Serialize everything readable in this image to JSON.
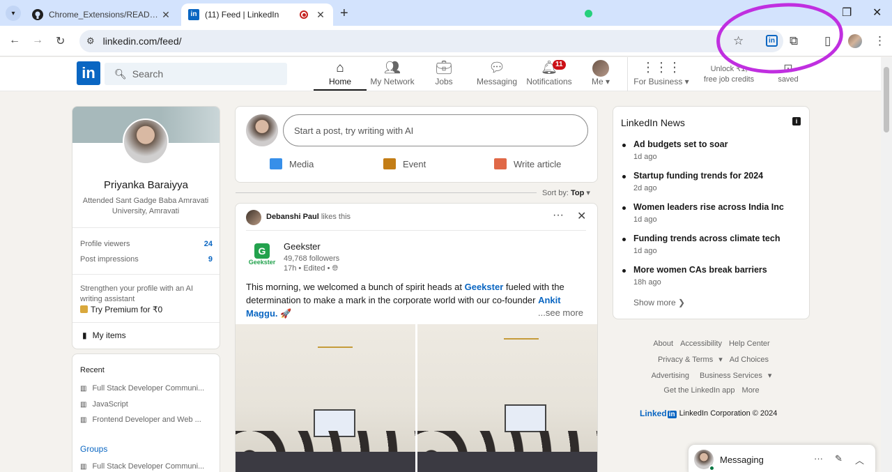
{
  "browser": {
    "tabs": [
      {
        "title": "Chrome_Extensions/README.m",
        "active": false,
        "icon": "github-icon"
      },
      {
        "title": "(11) Feed | LinkedIn",
        "active": true,
        "icon": "linkedin-icon"
      }
    ],
    "url": "linkedin.com/feed/"
  },
  "header": {
    "search_placeholder": "Search",
    "nav": [
      {
        "label": "Home",
        "icon": "home-icon"
      },
      {
        "label": "My Network",
        "icon": "network-icon"
      },
      {
        "label": "Jobs",
        "icon": "briefcase-icon"
      },
      {
        "label": "Messaging",
        "icon": "chat-icon"
      },
      {
        "label": "Notifications",
        "icon": "bell-icon",
        "badge": "11"
      },
      {
        "label": "Me",
        "icon": "avatar"
      },
      {
        "label": "For Business",
        "icon": "grid-icon"
      }
    ],
    "unlock_line1": "Unlock ₹1,",
    "unlock_line2": "free job credits",
    "saved": "saved"
  },
  "profile": {
    "name": "Priyanka Baraiyya",
    "subtitle": "Attended Sant Gadge Baba Amravati University, Amravati",
    "viewers_label": "Profile viewers",
    "viewers_value": "24",
    "impressions_label": "Post impressions",
    "impressions_value": "9",
    "premium_text": "Strengthen your profile with an AI writing assistant",
    "premium_link": "Try Premium for ₹0",
    "my_items": "My items"
  },
  "recent": {
    "heading": "Recent",
    "items": [
      "Full Stack Developer Communi...",
      "JavaScript",
      "Frontend Developer and Web ..."
    ],
    "groups_heading": "Groups",
    "groups_items": [
      "Full Stack Developer Communi..."
    ]
  },
  "share": {
    "placeholder": "Start a post, try writing with AI",
    "actions": [
      "Media",
      "Event",
      "Write article"
    ]
  },
  "sort": {
    "label": "Sort by:",
    "value": "Top"
  },
  "post": {
    "liker": "Debanshi Paul",
    "liker_action": "likes this",
    "company": "Geekster",
    "company_logo_text": "Geekster",
    "followers": "49,768 followers",
    "time": "17h • Edited •",
    "body_1": "This morning, we welcomed a bunch of spirit heads at ",
    "body_link1": "Geekster",
    "body_2": " fueled with the determination to make a mark in the corporate world with our co-founder ",
    "body_link2": "Ankit Maggu.",
    "body_emoji": " 🚀",
    "see_more": "...see more"
  },
  "news": {
    "title": "LinkedIn News",
    "items": [
      {
        "headline": "Ad budgets set to soar",
        "time": "1d ago"
      },
      {
        "headline": "Startup funding trends for 2024",
        "time": "2d ago"
      },
      {
        "headline": "Women leaders rise across India Inc",
        "time": "1d ago"
      },
      {
        "headline": "Funding trends across climate tech",
        "time": "1d ago"
      },
      {
        "headline": "More women CAs break barriers",
        "time": "18h ago"
      }
    ],
    "show_more": "Show more"
  },
  "footer": {
    "links": [
      "About",
      "Accessibility",
      "Help Center",
      "Privacy & Terms",
      "Ad Choices",
      "Advertising",
      "Business Services",
      "Get the LinkedIn app",
      "More"
    ],
    "brand": "Linked",
    "brand_in": "in",
    "copyright": "LinkedIn Corporation © 2024"
  },
  "messaging": {
    "label": "Messaging"
  },
  "colors": {
    "brand": "#0a66c2",
    "annotation": "#c02fe0"
  }
}
